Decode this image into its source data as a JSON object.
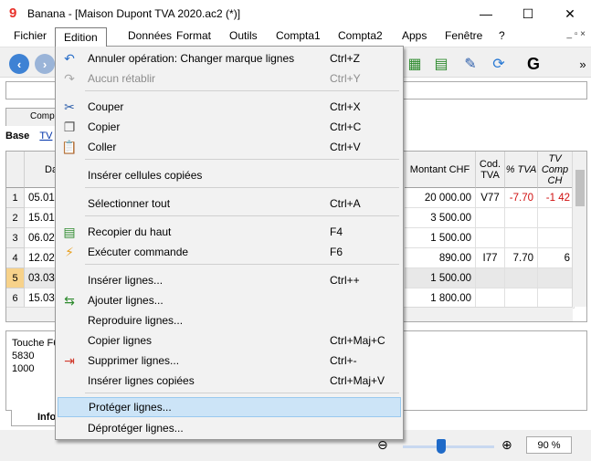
{
  "window": {
    "title": "Banana - [Maison Dupont TVA 2020.ac2 (*)]",
    "minimize": "—",
    "maximize": "☐",
    "close": "✕"
  },
  "menubar": {
    "items": [
      "Fichier",
      "Edition",
      "Données",
      "Format",
      "Outils",
      "Compta1",
      "Compta2",
      "Apps",
      "Fenêtre",
      "?"
    ],
    "mdi": "_ ▫ ×"
  },
  "toolbar": {
    "g_label": "G",
    "overflow": "»"
  },
  "tabs": {
    "comptes": "Comp",
    "base": "Base",
    "tva": "TV"
  },
  "grid": {
    "headers": [
      "Da",
      "Montant CHF",
      "Cod. TVA",
      "% TVA",
      "TV Comp CH"
    ],
    "rows": [
      {
        "no": "1",
        "date": "05.01",
        "montant": "20 000.00",
        "code": "V77",
        "pct": "-7.70",
        "tva": "-1 42"
      },
      {
        "no": "2",
        "date": "15.01",
        "montant": "3 500.00",
        "code": "",
        "pct": "",
        "tva": ""
      },
      {
        "no": "3",
        "date": "06.02",
        "montant": "1 500.00",
        "code": "",
        "pct": "",
        "tva": ""
      },
      {
        "no": "4",
        "date": "12.02",
        "montant": "890.00",
        "code": "I77",
        "pct": "7.70",
        "tva": "6"
      },
      {
        "no": "5",
        "date": "03.03",
        "montant": "1 500.00",
        "code": "",
        "pct": "",
        "tva": ""
      },
      {
        "no": "6",
        "date": "15.03",
        "montant": "1 800.00",
        "code": "",
        "pct": "",
        "tva": ""
      }
    ]
  },
  "info": {
    "line1": "Touche F6",
    "line2": "5830",
    "line3": "1000",
    "tab": "Info"
  },
  "status": {
    "zoom": "90 %"
  },
  "edit_menu": {
    "header": "Edition",
    "items": [
      {
        "label": "Annuler opération: Changer marque lignes",
        "shortcut": "Ctrl+Z",
        "icon": "undo-icon"
      },
      {
        "label": "Aucun rétablir",
        "shortcut": "Ctrl+Y",
        "icon": "redo-icon"
      },
      {
        "label": "Couper",
        "shortcut": "Ctrl+X",
        "icon": "scissors-icon"
      },
      {
        "label": "Copier",
        "shortcut": "Ctrl+C",
        "icon": "copy-icon"
      },
      {
        "label": "Coller",
        "shortcut": "Ctrl+V",
        "icon": "paste-icon"
      },
      {
        "label": "Insérer cellules copiées",
        "shortcut": "",
        "icon": ""
      },
      {
        "label": "Sélectionner tout",
        "shortcut": "Ctrl+A",
        "icon": ""
      },
      {
        "label": "Recopier du haut",
        "shortcut": "F4",
        "icon": "fill-down-icon"
      },
      {
        "label": "Exécuter commande",
        "shortcut": "F6",
        "icon": "lightning-icon"
      },
      {
        "label": "Insérer lignes...",
        "shortcut": "Ctrl++",
        "icon": ""
      },
      {
        "label": "Ajouter lignes...",
        "shortcut": "",
        "icon": "add-rows-icon"
      },
      {
        "label": "Reproduire lignes...",
        "shortcut": "",
        "icon": ""
      },
      {
        "label": "Copier lignes",
        "shortcut": "Ctrl+Maj+C",
        "icon": ""
      },
      {
        "label": "Supprimer lignes...",
        "shortcut": "Ctrl+-",
        "icon": "delete-rows-icon"
      },
      {
        "label": "Insérer lignes copiées",
        "shortcut": "Ctrl+Maj+V",
        "icon": ""
      },
      {
        "label": "Protéger lignes...",
        "shortcut": "",
        "icon": ""
      },
      {
        "label": "Déprotéger lignes...",
        "shortcut": "",
        "icon": ""
      }
    ]
  }
}
